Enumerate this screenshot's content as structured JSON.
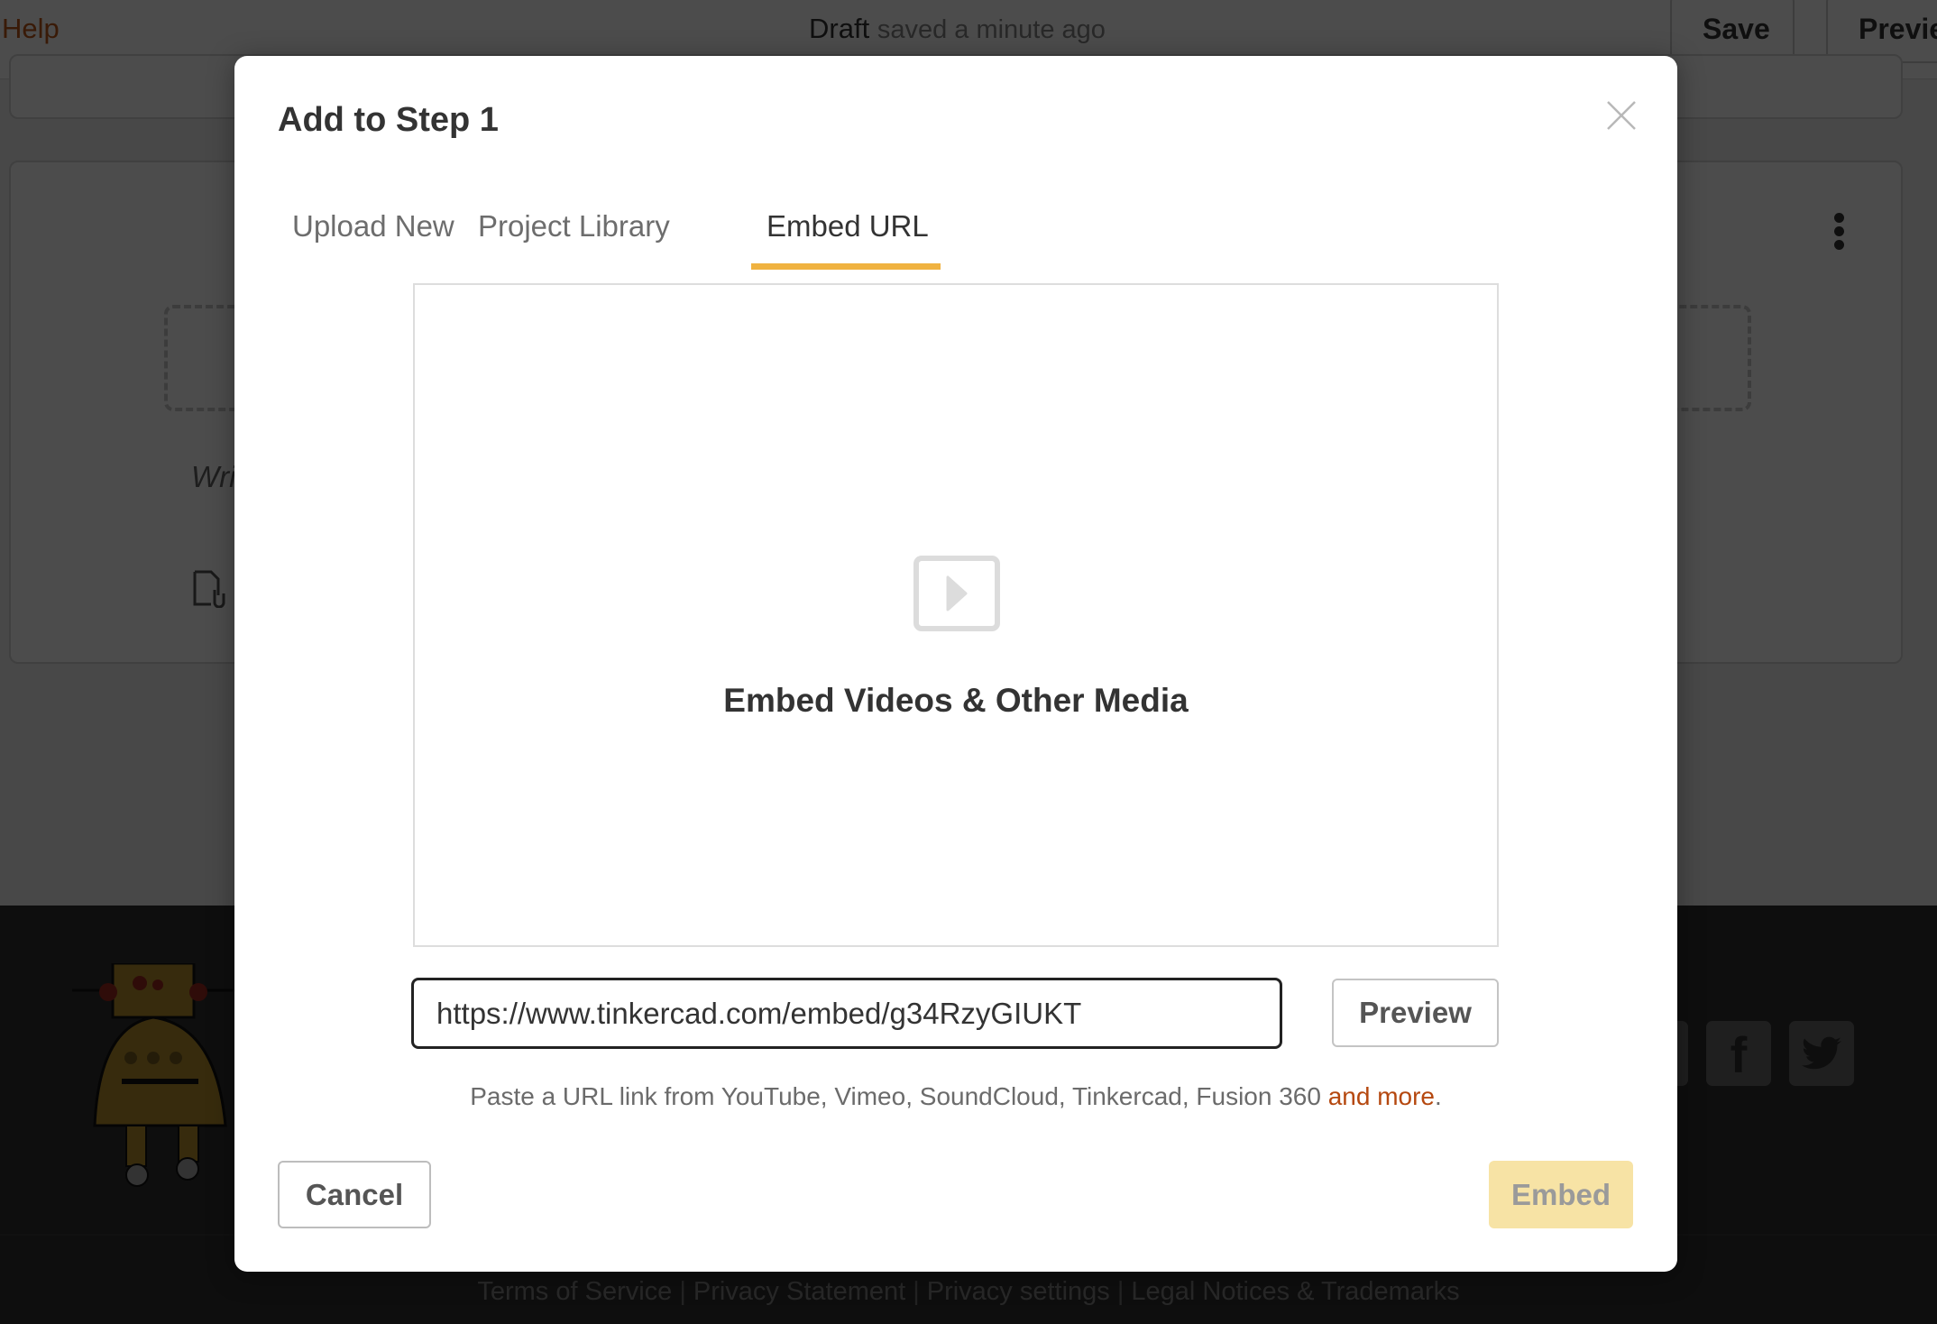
{
  "background": {
    "header": {
      "help_label": "Help",
      "draft_label": "Draft",
      "saved_status": "saved a minute ago",
      "save_label": "Save",
      "preview_label": "Previe"
    },
    "step_card": {
      "write_placeholder": "Wri"
    },
    "footer": {
      "legal_links": [
        "Terms of Service",
        "Privacy Statement",
        "Privacy settings",
        "Legal Notices & Trademarks"
      ],
      "social_icons": [
        "facebook-icon",
        "twitter-icon"
      ]
    }
  },
  "modal": {
    "title": "Add to Step 1",
    "close_icon": "close-icon",
    "tabs": [
      {
        "label": "Upload New",
        "active": false
      },
      {
        "label": "Project Library",
        "active": false
      },
      {
        "label": "Embed URL",
        "active": true
      }
    ],
    "media_preview": {
      "icon": "play-video-icon",
      "caption": "Embed Videos & Other Media"
    },
    "url_input": {
      "value": "https://www.tinkercad.com/embed/g34RzyGIUKT"
    },
    "preview_label": "Preview",
    "help_text": "Paste a URL link from YouTube, Vimeo, SoundCloud, Tinkercad, Fusion 360 ",
    "help_link": "and more",
    "help_suffix": ".",
    "cancel_label": "Cancel",
    "embed_label": "Embed",
    "colors": {
      "accent_tab": "#f0b240",
      "embed_disabled_bg": "#f7e3a5",
      "link": "#b5480f"
    }
  }
}
